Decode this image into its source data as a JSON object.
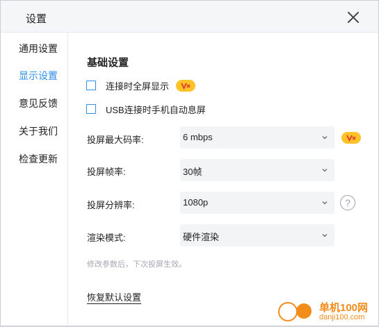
{
  "window": {
    "title": "设置"
  },
  "sidebar": {
    "items": [
      {
        "label": "通用设置",
        "active": false
      },
      {
        "label": "显示设置",
        "active": true
      },
      {
        "label": "意见反馈",
        "active": false
      },
      {
        "label": "关于我们",
        "active": false
      },
      {
        "label": "检查更新",
        "active": false
      }
    ]
  },
  "main": {
    "section_title": "基础设置",
    "checkboxes": [
      {
        "label": "连接时全屏显示",
        "checked": false,
        "vip": true
      },
      {
        "label": "USB连接时手机自动息屏",
        "checked": false,
        "vip": false
      }
    ],
    "fields": [
      {
        "label": "投屏最大码率:",
        "value": "6 mbps",
        "vip": true,
        "help": false
      },
      {
        "label": "投屏帧率:",
        "value": "30帧",
        "vip": false,
        "help": false
      },
      {
        "label": "投屏分辨率:",
        "value": "1080p",
        "vip": false,
        "help": true
      },
      {
        "label": "渲染模式:",
        "value": "硬件渲染",
        "vip": false,
        "help": false
      }
    ],
    "hint": "修改参数后，下次投屏生效。",
    "reset_label": "恢复默认设置"
  },
  "watermark": {
    "name": "单机100网",
    "url": "danji100.com"
  },
  "colors": {
    "accent": "#2e8ee8",
    "vip_badge": "#ffc32a",
    "vip_mark": "#e0442b",
    "watermark": "#f28c1b"
  },
  "icons": {
    "close": "close-icon",
    "dropdown": "chevron-down-icon",
    "help": "question-circle-icon",
    "vip": "vip-badge-icon"
  }
}
